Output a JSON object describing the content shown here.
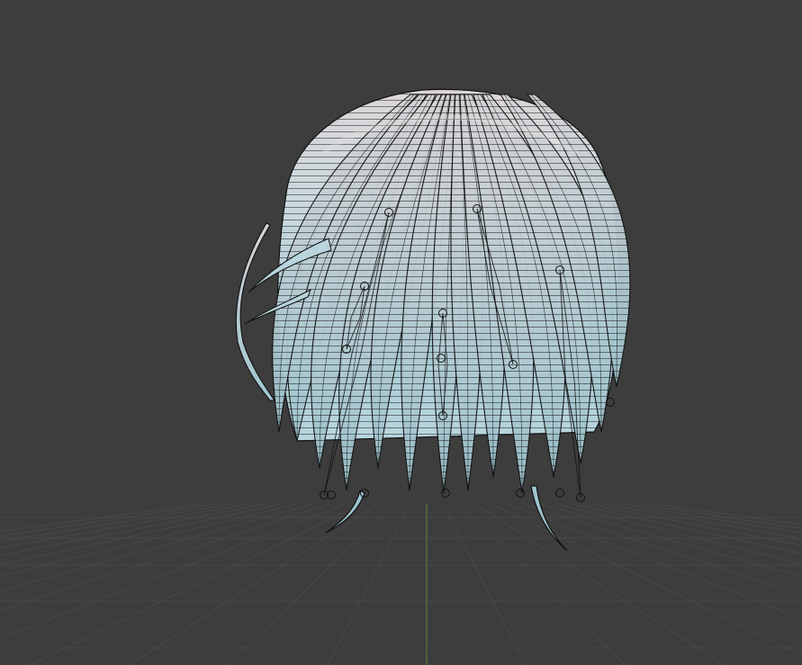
{
  "viewport": {
    "background": "#3d3d3d",
    "grid_color": "#4a4a4a",
    "z_axis_color": "#5b7a3a",
    "mesh_fill": "#a9cdd6",
    "mesh_highlight": "#d8d4d6",
    "wire_color": "#111111"
  },
  "scene": {
    "object": "hair-mesh",
    "display": "wireframe-overlay",
    "bones_visible": true
  }
}
